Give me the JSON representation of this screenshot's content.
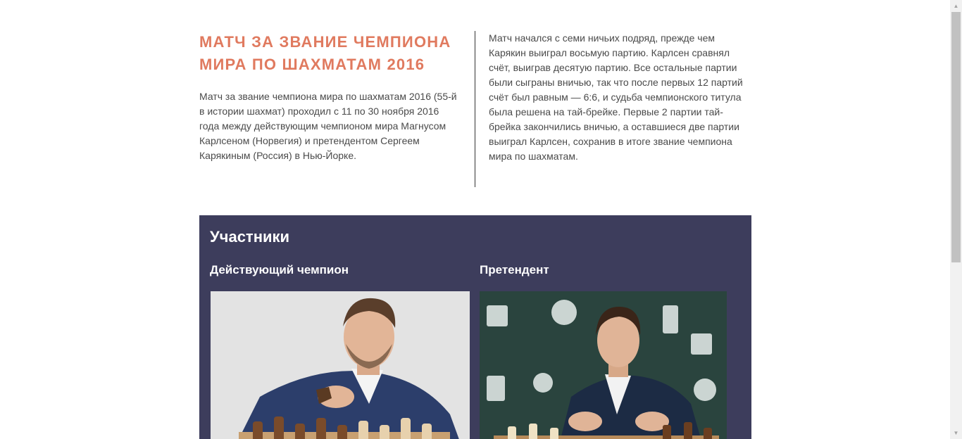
{
  "intro": {
    "title": "МАТЧ ЗА ЗВАНИЕ ЧЕМПИОНА МИРА ПО ШАХМАТАМ 2016",
    "lead": "Матч за звание чемпиона мира по шахматам 2016 (55-й в истории шахмат) проходил с 11 по 30 ноября 2016 года между действующим чемпионом мира Магнусом Карлсеном (Норвегия) и претендентом Сергеем Карякиным (Россия) в Нью-Йорке.",
    "details": "Матч начался с семи ничьих подряд, прежде чем Карякин выиграл восьмую партию. Карлсен сравнял счёт, выиграв десятую партию. Все остальные партии были сыграны вничью, так что после первых 12 партий счёт был равным — 6:6, и судьба чемпионского титула была решена на тай-брейке. Первые 2 партии тай-брейка закончились вничью, а оставшиеся две партии выиграл Карлсен, сохранив в итоге звание чемпиона мира по шахматам."
  },
  "participants": {
    "title": "Участники",
    "champion": {
      "role": "Действующий чемпион"
    },
    "challenger": {
      "role": "Претендент"
    }
  },
  "colors": {
    "title_accent": "#e07a5f",
    "panel_bg": "#3d3d5c",
    "text": "#4a4a4a"
  },
  "icons": {
    "scroll_up": "scroll-up-arrow-icon",
    "scroll_down": "scroll-down-arrow-icon"
  }
}
